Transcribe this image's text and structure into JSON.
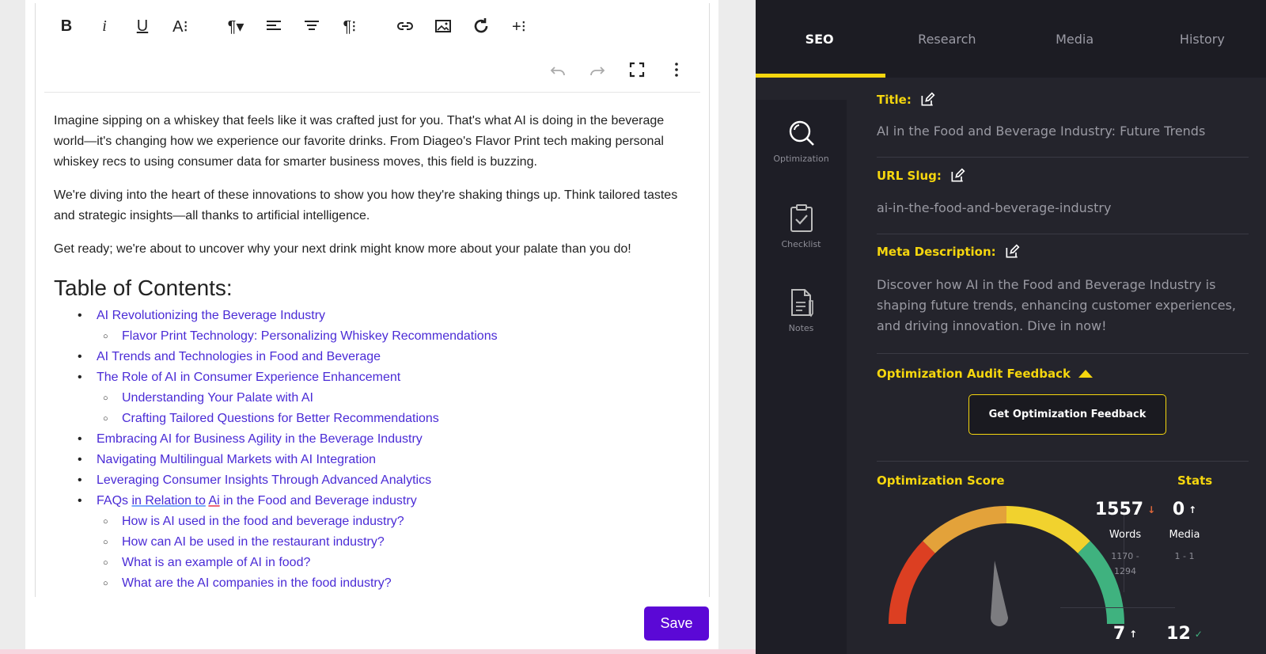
{
  "editor": {
    "paragraphs": [
      "Imagine sipping on a whiskey that feels like it was crafted just for you. That's what AI is doing in the beverage world—it's changing how we experience our favorite drinks. From Diageo's Flavor Print tech making personal whiskey recs to using consumer data for smarter business moves, this field is buzzing.",
      "We're diving into the heart of these innovations to show you how they're shaking things up. Think tailored tastes and strategic insights—all thanks to artificial intelligence.",
      "Get ready; we're about to uncover why your next drink might know more about your palate than you do!"
    ],
    "toc_title": "Table of Contents:",
    "toc": [
      {
        "text": "AI Revolutionizing the Beverage Industry",
        "level": 1
      },
      {
        "text": "Flavor Print Technology: Personalizing Whiskey Recommendations",
        "level": 2
      },
      {
        "text": "AI Trends and Technologies in Food and Beverage",
        "level": 1
      },
      {
        "text": "The Role of AI in Consumer Experience Enhancement",
        "level": 1
      },
      {
        "text": "Understanding Your Palate with AI",
        "level": 2
      },
      {
        "text": "Crafting Tailored Questions for Better Recommendations",
        "level": 2
      },
      {
        "text": "Embracing AI for Business Agility in the Beverage Industry",
        "level": 1
      },
      {
        "text": "Navigating Multilingual Markets with AI Integration",
        "level": 1
      },
      {
        "text": "Leveraging Consumer Insights Through Advanced Analytics",
        "level": 1
      },
      {
        "text": "FAQs in Relation to Ai in the Food and Beverage industry",
        "level": 1
      },
      {
        "text": "How is AI used in the food and beverage industry?",
        "level": 2
      },
      {
        "text": "How can AI be used in the restaurant industry?",
        "level": 2
      },
      {
        "text": "What is an example of AI in food?",
        "level": 2
      },
      {
        "text": "What are the AI companies in the food industry?",
        "level": 2
      }
    ],
    "save_label": "Save"
  },
  "tabs": [
    "SEO",
    "Research",
    "Media",
    "History"
  ],
  "side_nav": [
    {
      "label": "Optimization",
      "icon": "search-icon"
    },
    {
      "label": "Checklist",
      "icon": "clipboard-check-icon"
    },
    {
      "label": "Notes",
      "icon": "notes-icon"
    }
  ],
  "seo": {
    "title_label": "Title:",
    "title_value": "AI in the Food and Beverage Industry: Future Trends",
    "slug_label": "URL Slug:",
    "slug_value": "ai-in-the-food-and-beverage-industry",
    "meta_label": "Meta Description:",
    "meta_value": "Discover how AI in the Food and Beverage Industry is shaping future trends, enhancing customer experiences, and driving innovation. Dive in now!",
    "audit_label": "Optimization Audit Feedback",
    "feedback_button": "Get Optimization Feedback",
    "score_label": "Optimization Score",
    "stats_label": "Stats"
  },
  "stats": {
    "words": {
      "value": "1557",
      "label": "Words",
      "range_top": "1170 -",
      "range_bottom": "1294",
      "trend": "↓"
    },
    "media": {
      "value": "0",
      "label": "Media",
      "range": "1 - 1",
      "trend": "↑"
    },
    "stat3": {
      "value": "7",
      "trend": "↑"
    },
    "stat4": {
      "value": "12",
      "trend": "✓"
    }
  },
  "colors": {
    "accent": "#f5d60e",
    "save_button": "#5b08d6",
    "link": "#4a2bd6",
    "gauge": [
      "#dc3f22",
      "#e3a23a",
      "#f1d22e",
      "#3fb27f"
    ]
  }
}
